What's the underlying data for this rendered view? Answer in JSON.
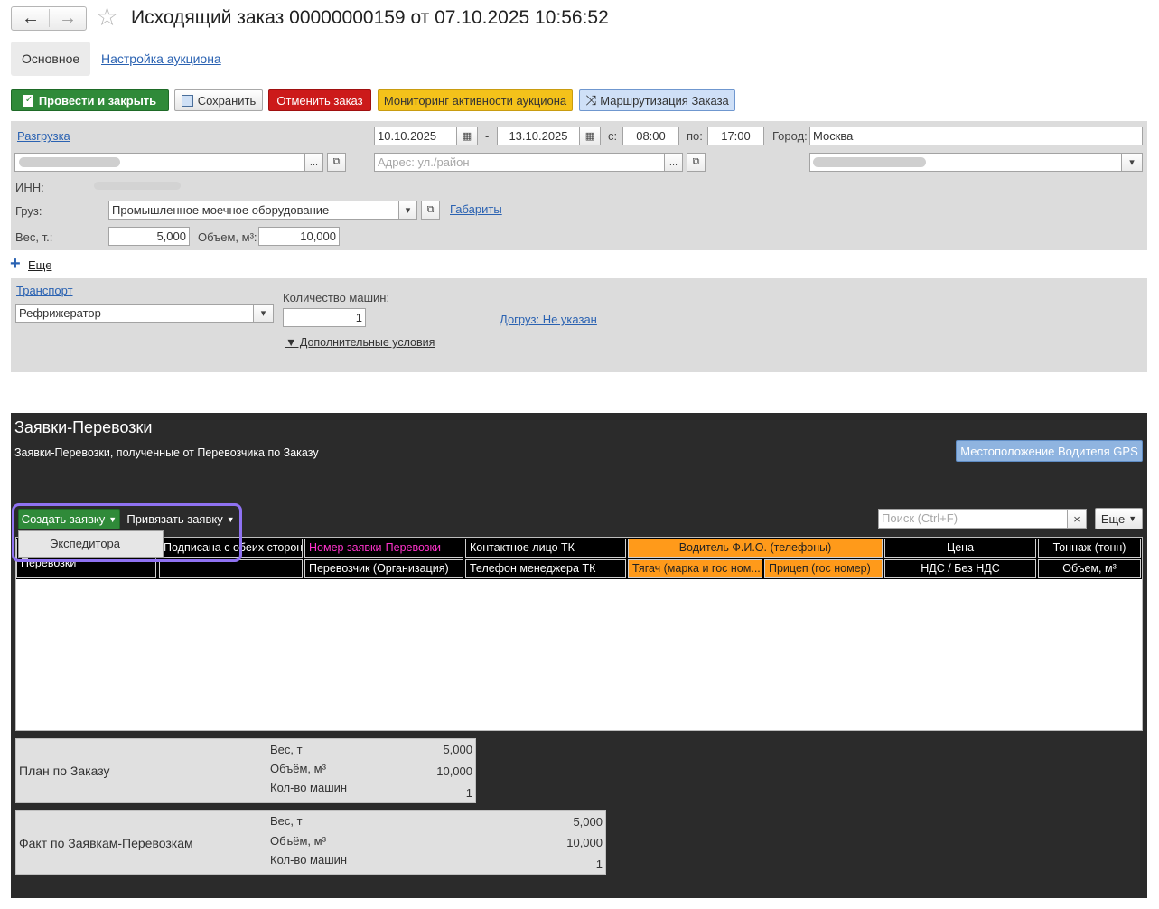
{
  "window": {
    "title": "Исходящий заказ 00000000159 от 07.10.2025 10:56:52",
    "nav_back": "←",
    "nav_forward": "→",
    "star": "☆"
  },
  "tabs": [
    {
      "label": "Основное"
    },
    {
      "label": "Настройка аукциона"
    }
  ],
  "toolbar": {
    "post_close": "Провести и закрыть",
    "save": "Сохранить",
    "cancel_order": "Отменить заказ",
    "monitoring": "Мониторинг активности аукциона",
    "routing": "Маршрутизация Заказа"
  },
  "unload": {
    "link": "Разгрузка",
    "date_from": "10.10.2025",
    "dash": "-",
    "date_to": "13.10.2025",
    "time_from_label": "с:",
    "time_from": "08:00",
    "time_to_label": "по:",
    "time_to": "17:00",
    "city_label": "Город:",
    "city": "Москва",
    "address_placeholder": "Адрес: ул./район",
    "inn_label": "ИНН:",
    "cargo_label": "Груз:",
    "cargo": "Промышленное моечное оборудование",
    "dimensions_link": "Габариты",
    "weight_label": "Вес, т.:",
    "weight": "5,000",
    "volume_label": "Объем, м³:",
    "volume": "10,000"
  },
  "more_link": "Еще",
  "transport": {
    "link": "Транспорт",
    "type": "Рефрижератор",
    "cars_label": "Количество машин:",
    "cars": "1",
    "extra_link": "Догруз: Не указан",
    "additional": "▼ Дополнительные условия"
  },
  "requests": {
    "title": "Заявки-Перевозки",
    "subtitle": "Заявки-Перевозки, полученные от Перевозчика по Заказу",
    "gps_button": "Местоположение Водителя GPS",
    "create_button": "Создать заявку",
    "bind_button": "Привязать заявку",
    "dropdown_item": "Экспедитора",
    "search_placeholder": "Поиск (Ctrl+F)",
    "search_clear": "×",
    "more_button": "Еще",
    "columns_row1": [
      "Перевозки",
      "Подписана с обеих сторон",
      "Номер заявки-Перевозки",
      "Контактное лицо ТК",
      "Водитель Ф.И.О. (телефоны)",
      "Цена",
      "Тоннаж (тонн)"
    ],
    "columns_row2": [
      "Перевозчик (Организация)",
      "Телефон менеджера ТК",
      "Тягач (марка и гос ном...",
      "Прицеп (гос номер)",
      "НДС / Без НДС",
      "Объем, м³"
    ]
  },
  "plan": {
    "label": "План по Заказу",
    "weight_label": "Вес, т",
    "weight": "5,000",
    "volume_label": "Объём, м³",
    "volume": "10,000",
    "cars_label": "Кол-во машин",
    "cars": "1"
  },
  "fact": {
    "label": "Факт по Заявкам-Перевозкам",
    "weight_label": "Вес, т",
    "weight": "5,000",
    "volume_label": "Объём, м³",
    "volume": "10,000",
    "cars_label": "Кол-во машин",
    "cars": "1"
  },
  "colors": {
    "green": "#2e8b3a",
    "red": "#cc1a1a",
    "yellow": "#f4c21a",
    "blue_btn": "#cfe0f7",
    "orange": "#ff9a1a",
    "magenta": "#ff33cc",
    "highlight": "#8f72f2"
  }
}
